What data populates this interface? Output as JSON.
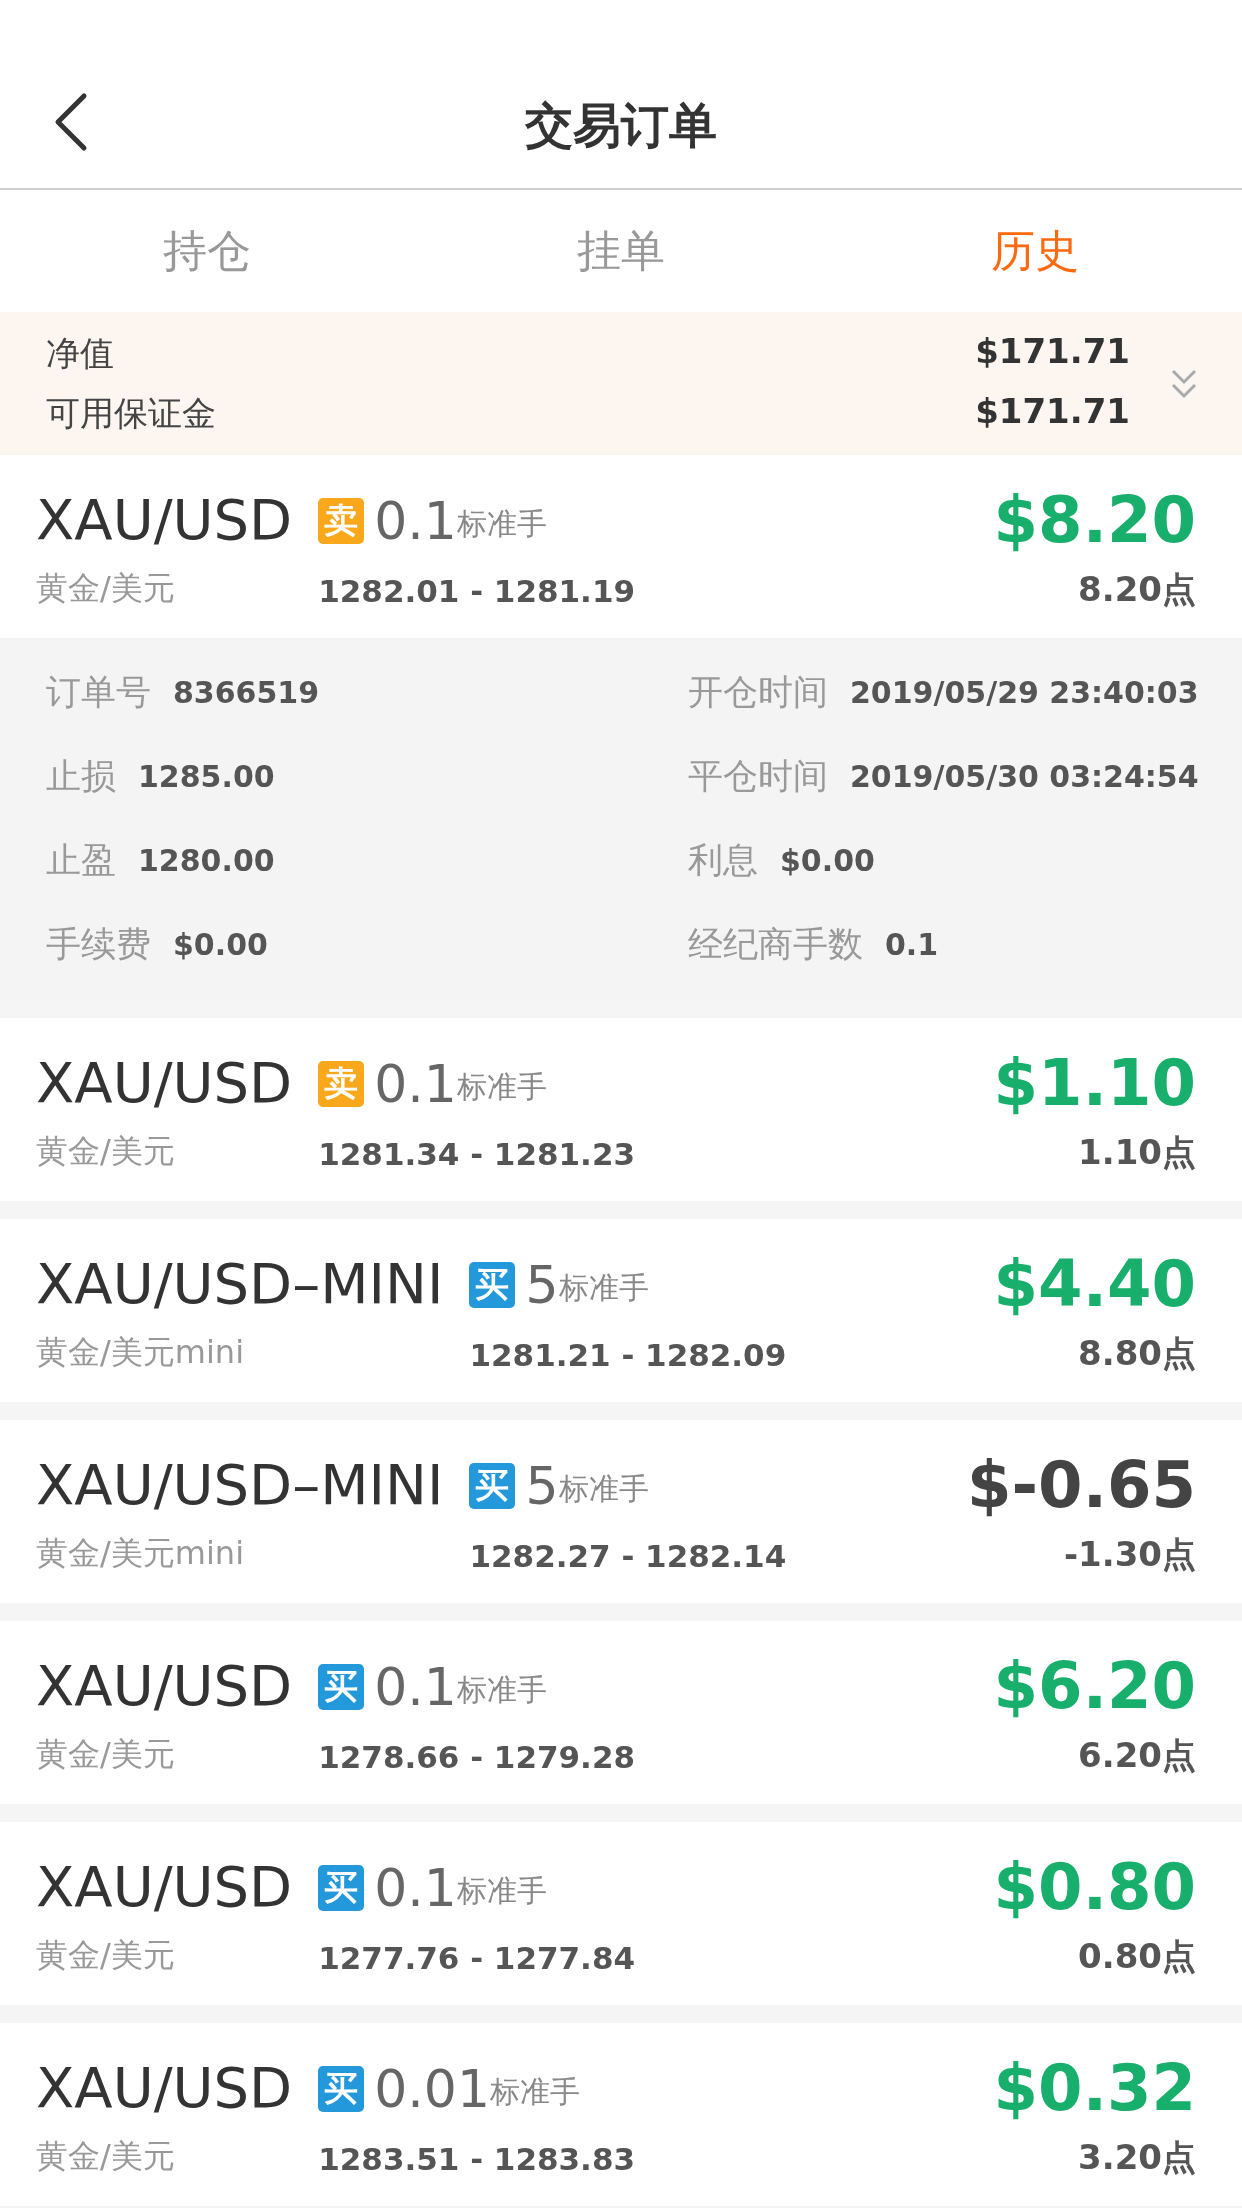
{
  "header": {
    "title": "交易订单"
  },
  "tabs": [
    {
      "label": "持仓",
      "selected": false
    },
    {
      "label": "挂单",
      "selected": false
    },
    {
      "label": "历史",
      "selected": true
    }
  ],
  "summary": {
    "rows": [
      {
        "label": "净值",
        "value": "$171.71"
      },
      {
        "label": "可用保证金",
        "value": "$171.71"
      }
    ],
    "expanded": false
  },
  "orders": [
    {
      "symbol": "XAU/USD",
      "name": "黄金/美元",
      "side": {
        "kind": "sell",
        "label": "卖"
      },
      "lots": "0.1",
      "unit": "标准手",
      "prices": "1282.01 - 1281.19",
      "profit": "$8.20",
      "points": "8.20点",
      "gain": true,
      "details": [
        {
          "label": "订单号",
          "value": "8366519"
        },
        {
          "label": "开仓时间",
          "value": "2019/05/29 23:40:03"
        },
        {
          "label": "止损",
          "value": "1285.00"
        },
        {
          "label": "平仓时间",
          "value": "2019/05/30 03:24:54"
        },
        {
          "label": "止盈",
          "value": "1280.00"
        },
        {
          "label": "利息",
          "value": "$0.00"
        },
        {
          "label": "手续费",
          "value": "$0.00"
        },
        {
          "label": "经纪商手数",
          "value": "0.1"
        }
      ]
    },
    {
      "symbol": "XAU/USD",
      "name": "黄金/美元",
      "side": {
        "kind": "sell",
        "label": "卖"
      },
      "lots": "0.1",
      "unit": "标准手",
      "prices": "1281.34 - 1281.23",
      "profit": "$1.10",
      "points": "1.10点",
      "gain": true
    },
    {
      "symbol": "XAU/USD–MINI",
      "name": "黄金/美元mini",
      "side": {
        "kind": "buy",
        "label": "买"
      },
      "lots": "5",
      "unit": "标准手",
      "prices": "1281.21 - 1282.09",
      "profit": "$4.40",
      "points": "8.80点",
      "gain": true
    },
    {
      "symbol": "XAU/USD–MINI",
      "name": "黄金/美元mini",
      "side": {
        "kind": "buy",
        "label": "买"
      },
      "lots": "5",
      "unit": "标准手",
      "prices": "1282.27 - 1282.14",
      "profit": "$-0.65",
      "points": "-1.30点",
      "gain": false
    },
    {
      "symbol": "XAU/USD",
      "name": "黄金/美元",
      "side": {
        "kind": "buy",
        "label": "买"
      },
      "lots": "0.1",
      "unit": "标准手",
      "prices": "1278.66 - 1279.28",
      "profit": "$6.20",
      "points": "6.20点",
      "gain": true
    },
    {
      "symbol": "XAU/USD",
      "name": "黄金/美元",
      "side": {
        "kind": "buy",
        "label": "买"
      },
      "lots": "0.1",
      "unit": "标准手",
      "prices": "1277.76 - 1277.84",
      "profit": "$0.80",
      "points": "0.80点",
      "gain": true
    },
    {
      "symbol": "XAU/USD",
      "name": "黄金/美元",
      "side": {
        "kind": "buy",
        "label": "买"
      },
      "lots": "0.01",
      "unit": "标准手",
      "prices": "1283.51 - 1283.83",
      "profit": "$0.32",
      "points": "3.20点",
      "gain": true
    }
  ]
}
